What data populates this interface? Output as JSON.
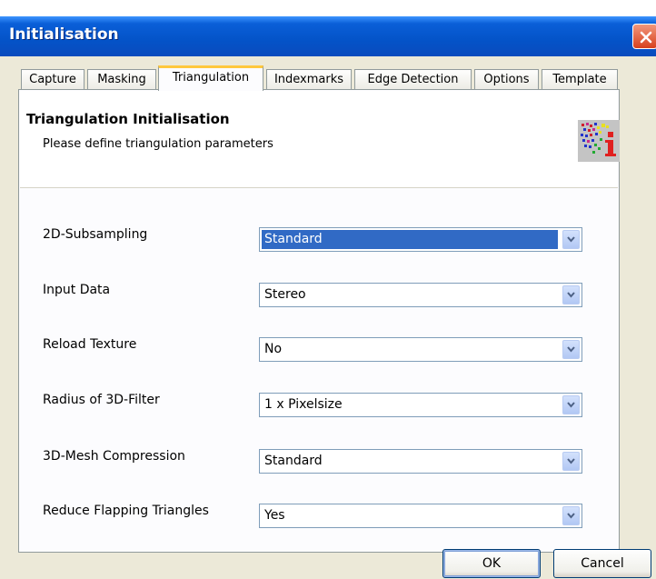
{
  "window": {
    "title": "Initialisation"
  },
  "tabs": [
    {
      "label": "Capture"
    },
    {
      "label": "Masking"
    },
    {
      "label": "Triangulation"
    },
    {
      "label": "Indexmarks"
    },
    {
      "label": "Edge Detection"
    },
    {
      "label": "Options"
    },
    {
      "label": "Template"
    }
  ],
  "active_tab": "Triangulation",
  "header": {
    "title": "Triangulation Initialisation",
    "subtitle": "Please define triangulation parameters"
  },
  "fields": [
    {
      "label": "2D-Subsampling",
      "value": "Standard"
    },
    {
      "label": "Input Data",
      "value": "Stereo"
    },
    {
      "label": "Reload Texture",
      "value": "No"
    },
    {
      "label": "Radius of 3D-Filter",
      "value": "1 x Pixelsize"
    },
    {
      "label": "3D-Mesh Compression",
      "value": "Standard"
    },
    {
      "label": "Reduce Flapping Triangles",
      "value": "Yes"
    }
  ],
  "buttons": {
    "ok": "OK",
    "cancel": "Cancel"
  },
  "colors": {
    "titlebar": "#0453c8",
    "dialog_bg": "#ece9d8",
    "selection": "#316ac5",
    "active_tab_accent": "#ffc83c"
  },
  "icons": {
    "close": "close-icon",
    "header": "triangulation-info-icon",
    "dropdown": "chevron-down-icon"
  }
}
